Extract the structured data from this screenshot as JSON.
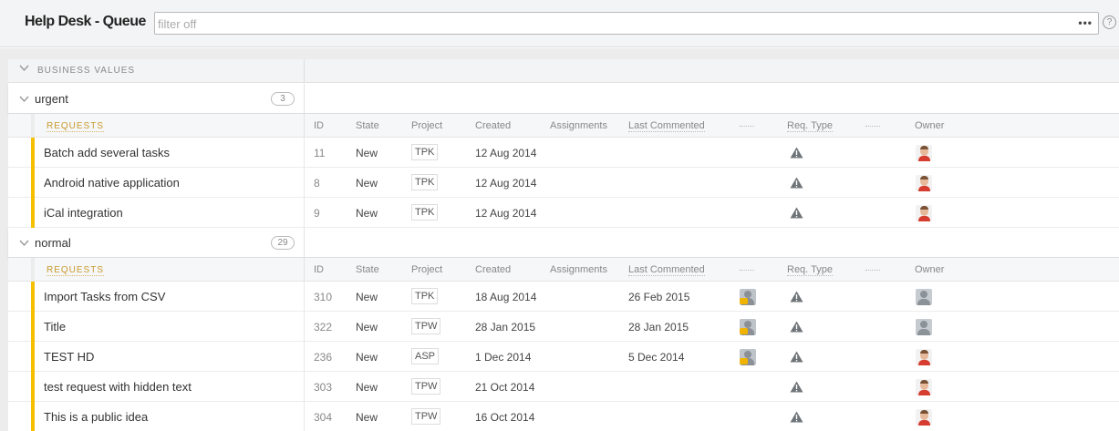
{
  "header": {
    "title": "Help Desk - Queue",
    "filter_placeholder": "filter off",
    "more_label": "•••",
    "help_label": "?"
  },
  "section": {
    "label": "BUSINESS VALUES"
  },
  "columns": {
    "requests": "REQUESTS",
    "id": "ID",
    "state": "State",
    "project": "Project",
    "created": "Created",
    "assignments": "Assignments",
    "last_commented": "Last Commented",
    "req_type": "Req. Type",
    "owner": "Owner"
  },
  "groups": [
    {
      "name": "urgent",
      "count": "3",
      "rows": [
        {
          "name": "Batch add several tasks",
          "id": "11",
          "state": "New",
          "project": "TPK",
          "created": "12 Aug 2014",
          "last_commented": "",
          "assignment_icon": false,
          "owner_icon": "owner-photo-icon"
        },
        {
          "name": "Android native application",
          "id": "8",
          "state": "New",
          "project": "TPK",
          "created": "12 Aug 2014",
          "last_commented": "",
          "assignment_icon": false,
          "owner_icon": "owner-photo-icon"
        },
        {
          "name": "iCal integration",
          "id": "9",
          "state": "New",
          "project": "TPK",
          "created": "12 Aug 2014",
          "last_commented": "",
          "assignment_icon": false,
          "owner_icon": "owner-photo-icon"
        }
      ]
    },
    {
      "name": "normal",
      "count": "29",
      "rows": [
        {
          "name": "Import Tasks from CSV",
          "id": "310",
          "state": "New",
          "project": "TPK",
          "created": "18 Aug 2014",
          "last_commented": "26 Feb 2015",
          "assignment_icon": true,
          "owner_icon": "owner-generic-icon"
        },
        {
          "name": "Title",
          "id": "322",
          "state": "New",
          "project": "TPW",
          "created": "28 Jan 2015",
          "last_commented": "28 Jan 2015",
          "assignment_icon": true,
          "owner_icon": "owner-generic-icon"
        },
        {
          "name": "TEST HD",
          "id": "236",
          "state": "New",
          "project": "ASP",
          "created": "1 Dec 2014",
          "last_commented": "5 Dec 2014",
          "assignment_icon": true,
          "owner_icon": "owner-photo-icon"
        },
        {
          "name": "test request with hidden text",
          "id": "303",
          "state": "New",
          "project": "TPW",
          "created": "21 Oct 2014",
          "last_commented": "",
          "assignment_icon": false,
          "owner_icon": "owner-photo-icon"
        },
        {
          "name": "This is a public idea",
          "id": "304",
          "state": "New",
          "project": "TPW",
          "created": "16 Oct 2014",
          "last_commented": "",
          "assignment_icon": false,
          "owner_icon": "owner-photo-icon"
        }
      ]
    }
  ],
  "colors": {
    "priority_bar": "#f5c000",
    "requests_label": "#c89a2e",
    "warning_icon": "#6f7478"
  }
}
